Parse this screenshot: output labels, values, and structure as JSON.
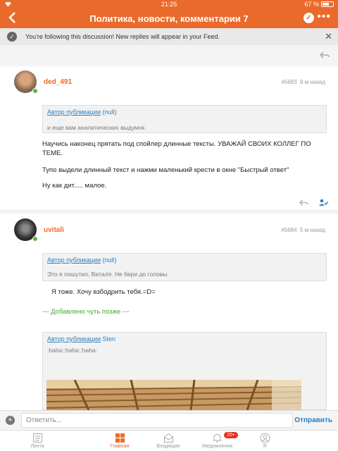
{
  "status": {
    "time": "21:25",
    "battery_text": "67 %",
    "battery_level": 0.67
  },
  "header": {
    "title": "Политика, новости, комментарии 7"
  },
  "follow_banner": {
    "text": "You're following this discussion! New replies will appear in your Feed."
  },
  "posts": [
    {
      "author": "ded_491",
      "number": "#5683",
      "time": "9 м назад",
      "quote": {
        "label": "Автор публикации",
        "name": "(null)",
        "text": "и еще вам аналитических выдумок."
      },
      "paragraphs": [
        "Научись наконец прятать под спойлер длинные тексты. УВАЖАЙ СВОИХ КОЛЛЕГ ПО ТЕМЕ.",
        "Тупо выдели длинный текст и нажми маленький крести в окне \"Быстрый ответ\"",
        "Ну как дит..... малое."
      ]
    },
    {
      "author": "uvitali",
      "number": "#5684",
      "time": "5 м назад",
      "quote": {
        "label": "Автор публикации",
        "name": "(null)",
        "text": "Это я пошутил, Виталя.  Не бери до головы"
      },
      "reply": "Я тоже. Хочу взбодрить тебя.=D=",
      "added_later": "--- Добавлено чуть позже ---",
      "quote2": {
        "label": "Автор публикации",
        "name": "Sten",
        "text": ":haha::haha::haha:"
      }
    }
  ],
  "composer": {
    "placeholder": "Ответить...",
    "send_label": "Отправить"
  },
  "tabs": [
    {
      "label": "Лента",
      "icon": "feed-icon"
    },
    {
      "label": "Главная",
      "icon": "home-grid-icon",
      "active": true
    },
    {
      "label": "Входящие",
      "icon": "inbox-icon"
    },
    {
      "label": "Уведомления",
      "icon": "bell-icon",
      "badge": "20+"
    },
    {
      "label": "Я",
      "icon": "profile-icon"
    }
  ],
  "colors": {
    "accent": "#ea6a2b",
    "link": "#2a7fc1",
    "online": "#5bb53c",
    "badge": "#e52f20"
  }
}
